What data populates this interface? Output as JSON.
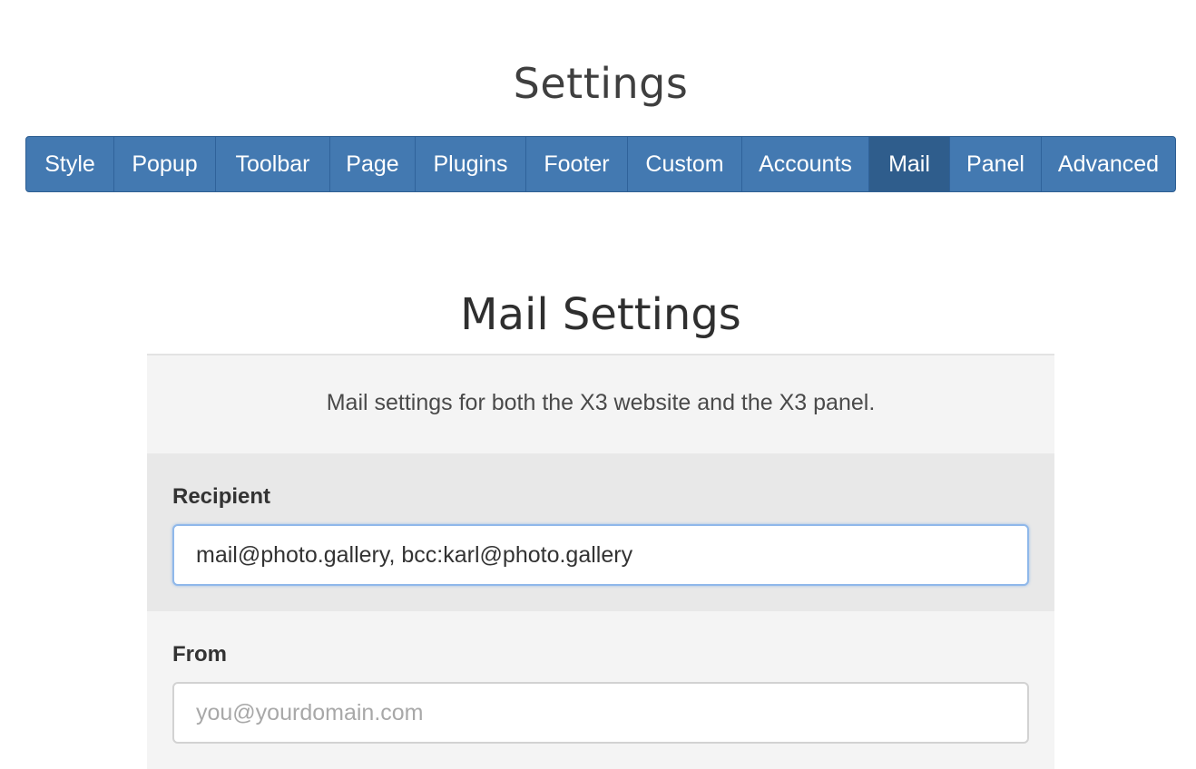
{
  "page": {
    "title": "Settings"
  },
  "tabs": [
    {
      "label": "Style",
      "active": false
    },
    {
      "label": "Popup",
      "active": false
    },
    {
      "label": "Toolbar",
      "active": false
    },
    {
      "label": "Page",
      "active": false
    },
    {
      "label": "Plugins",
      "active": false
    },
    {
      "label": "Footer",
      "active": false
    },
    {
      "label": "Custom",
      "active": false
    },
    {
      "label": "Accounts",
      "active": false
    },
    {
      "label": "Mail",
      "active": true
    },
    {
      "label": "Panel",
      "active": false
    },
    {
      "label": "Advanced",
      "active": false
    }
  ],
  "section": {
    "title": "Mail Settings",
    "description": "Mail settings for both the X3 website and the X3 panel."
  },
  "fields": {
    "recipient": {
      "label": "Recipient",
      "value": "mail@photo.gallery, bcc:karl@photo.gallery",
      "placeholder": ""
    },
    "from": {
      "label": "From",
      "value": "",
      "placeholder": "you@yourdomain.com"
    }
  },
  "colors": {
    "tab_background": "#4379b1",
    "tab_active_background": "#2f5d8c",
    "input_focus_border": "#8fb8ea"
  }
}
